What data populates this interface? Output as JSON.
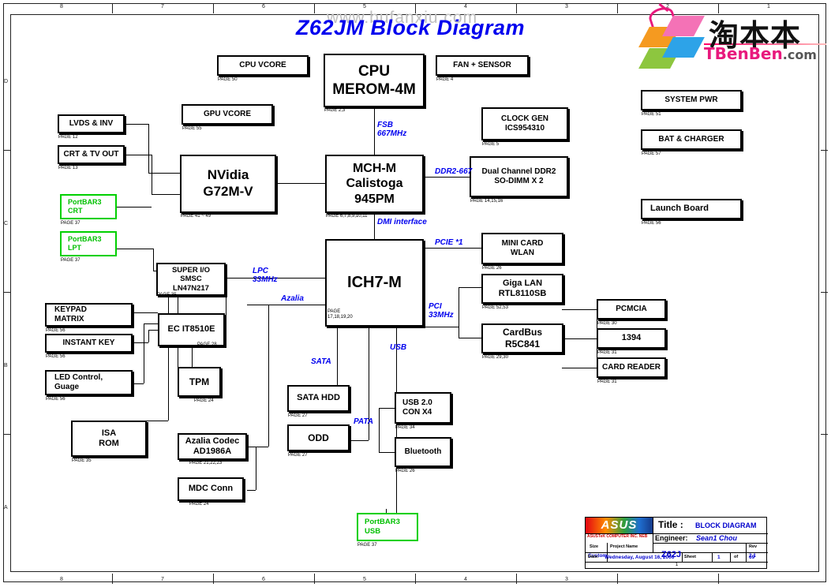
{
  "sheet": {
    "title": "Z62JM Block Diagram",
    "watermark": "www.bufanxiu.com"
  },
  "logo": {
    "chinese": "淘本本",
    "english": "TBenBen",
    "suffix": ".com"
  },
  "blocks": [
    {
      "id": "cpu-vcore",
      "label": "CPU VCORE",
      "page": "PAGE 50"
    },
    {
      "id": "cpu",
      "label": "CPU\nMEROM-4M",
      "page": "PAGE 2,3"
    },
    {
      "id": "fan-sensor",
      "label": "FAN + SENSOR",
      "page": "PAGE 4"
    },
    {
      "id": "gpu-vcore",
      "label": "GPU VCORE",
      "page": "PAGE 55"
    },
    {
      "id": "clock-gen",
      "label": "CLOCK GEN\nICS954310",
      "page": "PAGE 5"
    },
    {
      "id": "lvds-inv",
      "label": "LVDS & INV",
      "page": "PAGE 12"
    },
    {
      "id": "crt-tv-out",
      "label": "CRT & TV OUT",
      "page": "PAGE 13"
    },
    {
      "id": "nvidia-gpu",
      "label": "NVidia\nG72M-V",
      "page": "PAGE 41 ~ 49"
    },
    {
      "id": "mch",
      "label": "MCH-M\nCalistoga\n945PM",
      "page": "PAGE 6,7,8,9,10,11"
    },
    {
      "id": "ddr2",
      "label": "Dual Channel DDR2\nSO-DIMM X 2",
      "page": "PAGE 14,15,16"
    },
    {
      "id": "portbar3-crt",
      "label": "PortBAR3\nCRT",
      "page": "PAGE 37"
    },
    {
      "id": "portbar3-lpt",
      "label": "PortBAR3\nLPT",
      "page": "PAGE 37"
    },
    {
      "id": "super-io",
      "label": "SUPER I/O\nSMSC\nLN47N217",
      "page": "PAGE 35"
    },
    {
      "id": "ich7m",
      "label": "ICH7-M",
      "page": "PAGE\n17,18,19,20"
    },
    {
      "id": "mini-card",
      "label": "MINI CARD\nWLAN",
      "page": "PAGE 26"
    },
    {
      "id": "giga-lan",
      "label": "Giga LAN\nRTL8110SB",
      "page": "PAGE 52,53"
    },
    {
      "id": "cardbus",
      "label": "CardBus\nR5C841",
      "page": "PAGE 29,30"
    },
    {
      "id": "keypad",
      "label": "KEYPAD\nMATRIX",
      "page": "PAGE 56"
    },
    {
      "id": "instant-key",
      "label": "INSTANT KEY",
      "page": "PAGE 56"
    },
    {
      "id": "led-control",
      "label": "LED Control,\nGuage",
      "page": "PAGE 56"
    },
    {
      "id": "ec",
      "label": "EC IT8510E",
      "page": "PAGE 28"
    },
    {
      "id": "tpm",
      "label": "TPM",
      "page": "PAGE 24"
    },
    {
      "id": "isa-rom",
      "label": "ISA\nROM",
      "page": "PAGE 35"
    },
    {
      "id": "pcmcia",
      "label": "PCMCIA",
      "page": "PAGE 30"
    },
    {
      "id": "ieee1394",
      "label": "1394",
      "page": "PAGE 31"
    },
    {
      "id": "card-reader",
      "label": "CARD READER",
      "page": "PAGE 31"
    },
    {
      "id": "sata-hdd",
      "label": "SATA HDD",
      "page": "PAGE 27"
    },
    {
      "id": "odd",
      "label": "ODD",
      "page": "PAGE 27"
    },
    {
      "id": "usb20",
      "label": "USB 2.0\nCON X4",
      "page": "PAGE 34"
    },
    {
      "id": "bluetooth",
      "label": "Bluetooth",
      "page": "PAGE 26"
    },
    {
      "id": "azalia-codec",
      "label": "Azalia Codec\nAD1986A",
      "page": "PAGE 21,22,23"
    },
    {
      "id": "mdc-conn",
      "label": "MDC Conn",
      "page": "PAGE 24"
    },
    {
      "id": "portbar3-usb",
      "label": "PortBAR3\nUSB",
      "page": "PAGE 37"
    },
    {
      "id": "system-pwr",
      "label": "SYSTEM PWR",
      "page": "PAGE 51"
    },
    {
      "id": "bat-charger",
      "label": "BAT & CHARGER",
      "page": "PAGE 57"
    },
    {
      "id": "launch-board",
      "label": "Launch Board",
      "page": "PAGE 56"
    }
  ],
  "signals": {
    "fsb": "FSB\n667MHz",
    "ddr2_667": "DDR2-667",
    "dmi": "DMI interface",
    "pcie": "PCIE *1",
    "lpc": "LPC\n33MHz",
    "azalia": "Azalia",
    "pci": "PCI\n33MHz",
    "usb": "USB",
    "sata": "SATA",
    "pata": "PATA"
  },
  "title_block": {
    "brand": "ASUS",
    "company": "ASUSTeK COMPUTER INC. NEB",
    "title_label": "Title :",
    "title_value": "BLOCK DIAGRAM",
    "engineer_label": "Engineer:",
    "engineer_value": "Sean1 Chou",
    "size_label": "Size",
    "size_value": "Custom",
    "project_label": "Project Name",
    "project_value": "Z62J",
    "rev_label": "Rev",
    "rev_value": "2.1",
    "date_label": "Date:",
    "date_value": "Wednesday, August 16, 2006",
    "sheet_label": "Sheet",
    "sheet_value": "1",
    "of_label": "of",
    "total_value": "69",
    "page_number": "1"
  },
  "rulers": {
    "columns": [
      "8",
      "7",
      "6",
      "5",
      "4",
      "3",
      "2",
      "1"
    ],
    "rows": [
      "D",
      "C",
      "B",
      "A"
    ]
  }
}
